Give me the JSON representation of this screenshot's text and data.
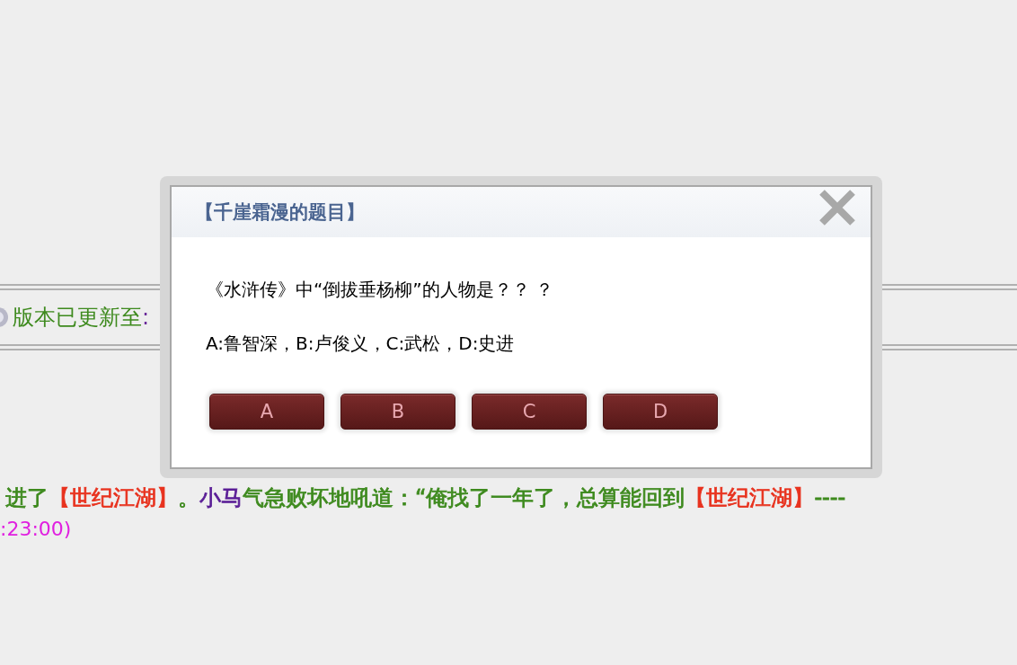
{
  "notice": {
    "segments": [
      {
        "text": "版本已更新至",
        "color": "#3e8a1e"
      },
      {
        "text": ":",
        "color": "#6a2a9a"
      }
    ]
  },
  "message": {
    "segments": [
      {
        "text": "进了",
        "color": "#3e8a1e"
      },
      {
        "text": "【世纪江湖】",
        "color": "#e8321e"
      },
      {
        "text": "。",
        "color": "#3e8a1e"
      },
      {
        "text": "小马",
        "color": "#5a1e96"
      },
      {
        "text": "气急败坏地吼道：“俺找了一年了，总算能回到",
        "color": "#3e8a1e"
      },
      {
        "text": "【世纪江湖】",
        "color": "#e8321e"
      },
      {
        "text": "----",
        "color": "#3e8a1e"
      }
    ]
  },
  "time": ":23:00)",
  "dialog": {
    "title": "【千崖霜漫的题目】",
    "question": "《水浒传》中“倒拔垂杨柳”的人物是？？ ？",
    "options": "A:鲁智深，B:卢俊义，C:武松，D:史进",
    "buttons": [
      "A",
      "B",
      "C",
      "D"
    ]
  }
}
